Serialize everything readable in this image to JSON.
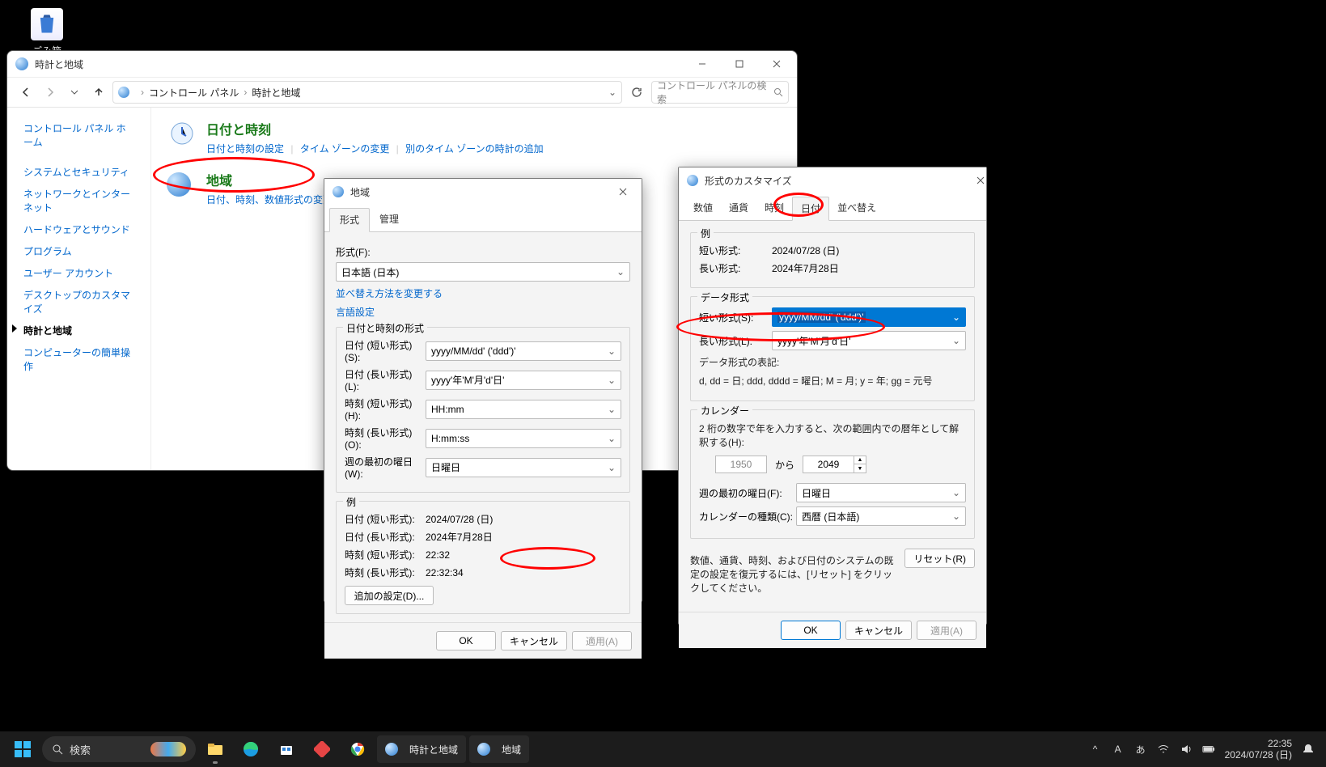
{
  "desktop": {
    "recycle_bin": "ごみ箱"
  },
  "control_panel": {
    "title": "時計と地域",
    "breadcrumb": {
      "root": "コントロール パネル",
      "current": "時計と地域"
    },
    "search_placeholder": "コントロール パネルの検索",
    "sidebar_home": "コントロール パネル ホーム",
    "sidebar_items": [
      "システムとセキュリティ",
      "ネットワークとインターネット",
      "ハードウェアとサウンド",
      "プログラム",
      "ユーザー アカウント",
      "デスクトップのカスタマイズ",
      "時計と地域",
      "コンピューターの簡単操作"
    ],
    "sidebar_current_index": 6,
    "cat_datetime": {
      "title": "日付と時刻",
      "links": [
        "日付と時刻の設定",
        "タイム ゾーンの変更",
        "別のタイム ゾーンの時計の追加"
      ]
    },
    "cat_region": {
      "title": "地域",
      "links": [
        "日付、時刻、数値形式の変更"
      ]
    }
  },
  "region_dialog": {
    "title": "地域",
    "tabs": [
      "形式",
      "管理"
    ],
    "active_tab": 0,
    "format_label": "形式(F):",
    "format_value": "日本語 (日本)",
    "sort_link": "並べ替え方法を変更する",
    "lang_link": "言語設定",
    "group_formats": "日付と時刻の形式",
    "rows": {
      "short_date_label": "日付 (短い形式)(S):",
      "short_date_value": "yyyy/MM/dd' ('ddd')'",
      "long_date_label": "日付 (長い形式)(L):",
      "long_date_value": "yyyy'年'M'月'd'日'",
      "short_time_label": "時刻 (短い形式)(H):",
      "short_time_value": "HH:mm",
      "long_time_label": "時刻 (長い形式)(O):",
      "long_time_value": "H:mm:ss",
      "first_day_label": "週の最初の曜日(W):",
      "first_day_value": "日曜日"
    },
    "example_label": "例",
    "examples": {
      "short_date_label": "日付 (短い形式):",
      "short_date_value": "2024/07/28 (日)",
      "long_date_label": "日付 (長い形式):",
      "long_date_value": "2024年7月28日",
      "short_time_label": "時刻 (短い形式):",
      "short_time_value": "22:32",
      "long_time_label": "時刻 (長い形式):",
      "long_time_value": "22:32:34"
    },
    "additional_settings": "追加の設定(D)...",
    "ok": "OK",
    "cancel": "キャンセル",
    "apply": "適用(A)"
  },
  "format_dialog": {
    "title": "形式のカスタマイズ",
    "tabs": [
      "数値",
      "通貨",
      "時刻",
      "日付",
      "並べ替え"
    ],
    "active_tab": 3,
    "example_label": "例",
    "ex_short_label": "短い形式:",
    "ex_short_value": "2024/07/28 (日)",
    "ex_long_label": "長い形式:",
    "ex_long_value": "2024年7月28日",
    "data_formats": "データ形式",
    "short_label": "短い形式(S):",
    "short_value": "yyyy/MM/dd' ('ddd')'",
    "long_label": "長い形式(L):",
    "long_value": "yyyy'年'M'月'd'日'",
    "notation_label": "データ形式の表記:",
    "notation_text": "d, dd = 日;  ddd, dddd = 曜日; M = 月; y = 年; gg = 元号",
    "calendar_label": "カレンダー",
    "two_digit_text": "2 桁の数字で年を入力すると、次の範囲内での暦年として解釈する(H):",
    "year_from": "1950",
    "to_word": "から",
    "year_to": "2049",
    "first_day_label": "週の最初の曜日(F):",
    "first_day_value": "日曜日",
    "cal_type_label": "カレンダーの種類(C):",
    "cal_type_value": "西暦 (日本語)",
    "reset_note": "数値、通貨、時刻、および日付のシステムの既定の設定を復元するには、[リセット] をクリックしてください。",
    "reset": "リセット(R)",
    "ok": "OK",
    "cancel": "キャンセル",
    "apply": "適用(A)"
  },
  "taskbar": {
    "search_placeholder": "検索",
    "app1": "時計と地域",
    "app2": "地域",
    "time": "22:35",
    "date": "2024/07/28 (日)"
  }
}
